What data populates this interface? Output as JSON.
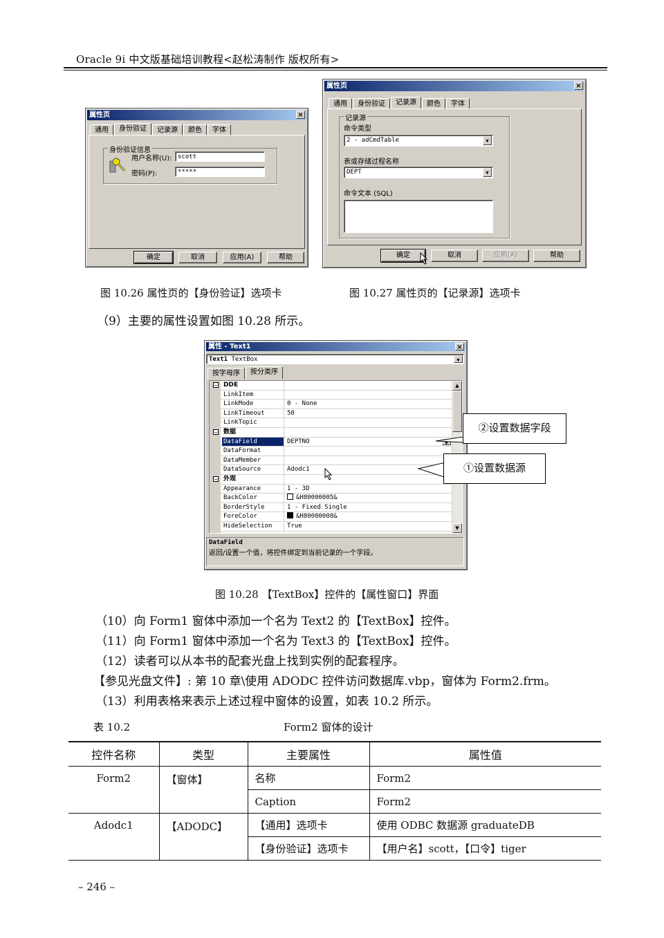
{
  "header": {
    "title": "Oracle  9i 中文版基础培训教程<赵松涛制作   版权所有>"
  },
  "fig26": {
    "window_title": "属性页",
    "tabs": [
      "通用",
      "身份验证",
      "记录源",
      "颜色",
      "字体"
    ],
    "active_tab": "身份验证",
    "group_label": "身份验证信息",
    "icon": "key-icon",
    "username_label": "用户名称(U):",
    "username_value": "scott",
    "password_label": "密码(P):",
    "password_value": "*****",
    "buttons": {
      "ok": "确定",
      "cancel": "取消",
      "apply": "应用(A)",
      "help": "帮助"
    },
    "caption": "图 10.26     属性页的【身份验证】选项卡"
  },
  "fig27": {
    "window_title": "属性页",
    "tabs": [
      "通用",
      "身份验证",
      "记录源",
      "颜色",
      "字体"
    ],
    "active_tab": "记录源",
    "group_label": "记录源",
    "command_type_label": "命令类型",
    "command_type_value": "2 - adCmdTable",
    "table_label": "表或存储过程名称",
    "table_value": "DEPT",
    "sql_label": "命令文本 (SQL)",
    "sql_value": "",
    "buttons": {
      "ok": "确定",
      "cancel": "取消",
      "apply": "应用(A)",
      "help": "帮助"
    },
    "caption": "图 10.27     属性页的【记录源】选项卡"
  },
  "step9": "（9）主要的属性设置如图 10.28 所示。",
  "fig28": {
    "window_title": "属性 - Text1",
    "object_selector_bold": "Text1",
    "object_selector_type": "TextBox",
    "tabs": [
      "按字母序",
      "按分类序"
    ],
    "active_tab": "按分类序",
    "rows": [
      {
        "kind": "category",
        "name": "DDE"
      },
      {
        "kind": "prop",
        "name": "LinkItem",
        "value": ""
      },
      {
        "kind": "prop",
        "name": "LinkMode",
        "value": "0 - None"
      },
      {
        "kind": "prop",
        "name": "LinkTimeout",
        "value": "50"
      },
      {
        "kind": "prop",
        "name": "LinkTopic",
        "value": ""
      },
      {
        "kind": "category",
        "name": "数据"
      },
      {
        "kind": "prop",
        "name": "DataField",
        "value": "DEPTNO",
        "selected": true
      },
      {
        "kind": "prop",
        "name": "DataFormat",
        "value": ""
      },
      {
        "kind": "prop",
        "name": "DataMember",
        "value": ""
      },
      {
        "kind": "prop",
        "name": "DataSource",
        "value": "Adodc1"
      },
      {
        "kind": "category",
        "name": "外观"
      },
      {
        "kind": "prop",
        "name": "Appearance",
        "value": "1 - 3D"
      },
      {
        "kind": "prop",
        "name": "BackColor",
        "value": "&H80000005&",
        "swatch": "#ffffff"
      },
      {
        "kind": "prop",
        "name": "BorderStyle",
        "value": "1 - Fixed Single"
      },
      {
        "kind": "prop",
        "name": "ForeColor",
        "value": "&H80000008&",
        "swatch": "#000000"
      },
      {
        "kind": "prop",
        "name": "HideSelection",
        "value": "True"
      }
    ],
    "description_title": "DataField",
    "description_text": "返回/设置一个值，将控件绑定到当前记录的一个字段。",
    "callouts": {
      "datafield": "②设置数据字段",
      "datasource": "①设置数据源"
    },
    "caption": "图 10.28    【TextBox】控件的【属性窗口】界面"
  },
  "paragraphs": [
    "（10）向 Form1 窗体中添加一个名为 Text2 的【TextBox】控件。",
    "（11）向 Form1 窗体中添加一个名为 Text3 的【TextBox】控件。",
    "（12）读者可以从本书的配套光盘上找到实例的配套程序。",
    "【参见光盘文件】: 第 10 章\\使用 ADODC 控件访问数据库.vbp，窗体为 Form2.frm。",
    "（13）利用表格来表示上述过程中窗体的设置，如表 10.2 所示。"
  ],
  "table": {
    "number": "表 10.2",
    "title": "Form2 窗体的设计",
    "headers": [
      "控件名称",
      "类型",
      "主要属性",
      "属性值"
    ],
    "groups": [
      {
        "name": "Form2",
        "type": "【窗体】",
        "props": [
          {
            "prop": "名称",
            "value": "Form2"
          },
          {
            "prop": "Caption",
            "value": "Form2"
          }
        ]
      },
      {
        "name": "Adodc1",
        "type": "【ADODC】",
        "props": [
          {
            "prop": "【通用】选项卡",
            "value": "使用 ODBC 数据源 graduateDB"
          },
          {
            "prop": "【身份验证】选项卡",
            "value": "【用户名】scott，【口令】tiger"
          }
        ]
      }
    ]
  },
  "footer": {
    "page_number": "– 246 –"
  }
}
